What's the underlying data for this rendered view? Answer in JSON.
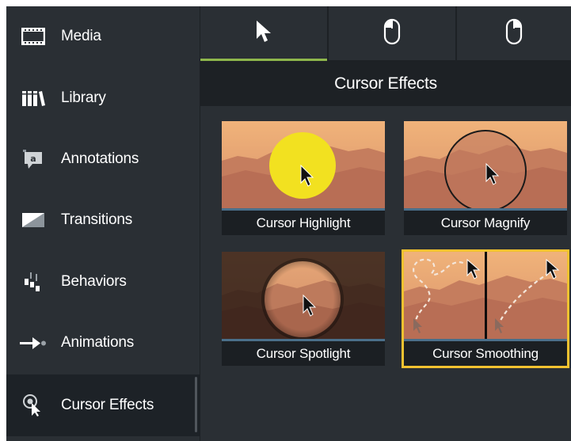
{
  "sidebar": {
    "items": [
      {
        "label": "Media",
        "icon": "film-icon"
      },
      {
        "label": "Library",
        "icon": "books-icon"
      },
      {
        "label": "Annotations",
        "icon": "annotation-icon"
      },
      {
        "label": "Transitions",
        "icon": "transition-icon"
      },
      {
        "label": "Behaviors",
        "icon": "behaviors-icon"
      },
      {
        "label": "Animations",
        "icon": "animation-arrow-icon"
      },
      {
        "label": "Cursor Effects",
        "icon": "cursor-effects-icon"
      }
    ],
    "active": "Cursor Effects"
  },
  "tabs": [
    {
      "icon": "cursor-arrow-icon",
      "active": true
    },
    {
      "icon": "mouse-left-click-icon",
      "active": false
    },
    {
      "icon": "mouse-right-click-icon",
      "active": false
    }
  ],
  "panel": {
    "title": "Cursor Effects",
    "cards": [
      {
        "label": "Cursor Highlight"
      },
      {
        "label": "Cursor Magnify"
      },
      {
        "label": "Cursor Spotlight"
      },
      {
        "label": "Cursor Smoothing",
        "selected": true
      }
    ]
  },
  "colors": {
    "accent_tab": "#8eb74c",
    "selected_outline": "#f2c230",
    "highlight_yellow": "#f2e120"
  }
}
